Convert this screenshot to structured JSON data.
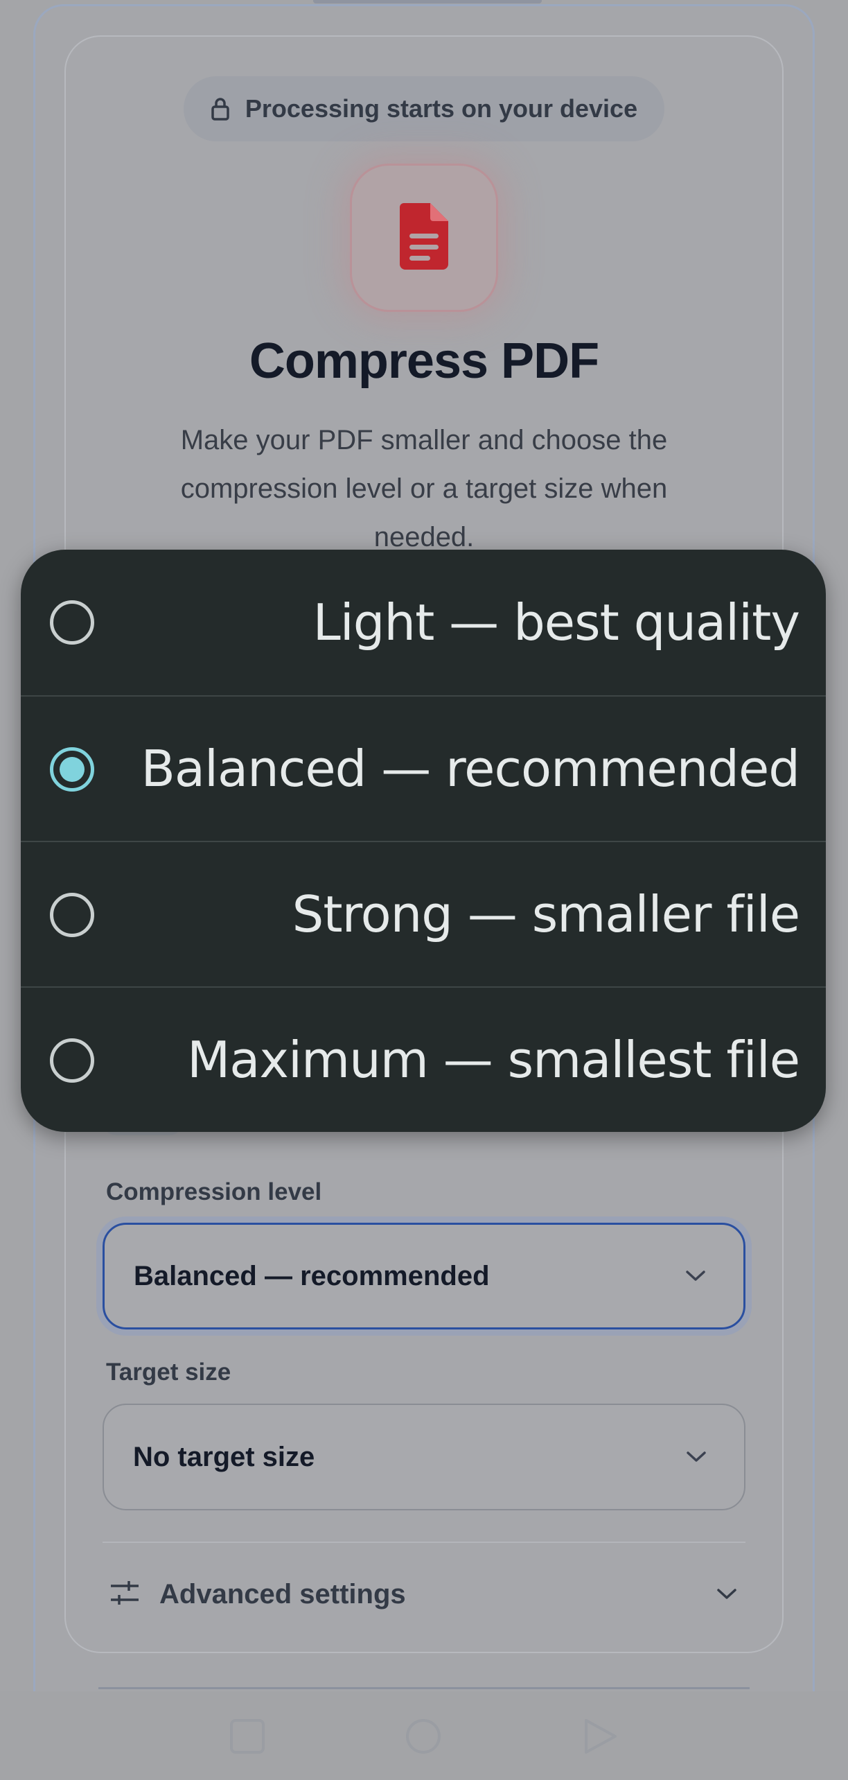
{
  "privacy_badge": {
    "text": "Processing starts on your device",
    "icon": "lock-icon"
  },
  "tool": {
    "icon": "pdf-file-icon",
    "title": "Compress PDF",
    "description": "Make your PDF smaller and choose the compression level or a target size when needed."
  },
  "compression_level": {
    "label": "Compression level",
    "selected": "Balanced — recommended",
    "options": [
      {
        "label": "Light — best quality",
        "checked": false
      },
      {
        "label": "Balanced — recommended",
        "checked": true
      },
      {
        "label": "Strong — smaller file",
        "checked": false
      },
      {
        "label": "Maximum — smallest file",
        "checked": false
      }
    ]
  },
  "target_size": {
    "label": "Target size",
    "selected": "No target size"
  },
  "advanced": {
    "label": "Advanced settings",
    "icon": "sliders-icon"
  },
  "colors": {
    "menu_background": "#242b2b",
    "radio_checked": "#80d3dd",
    "pdf_icon": "#c0262e",
    "focus_border": "#2a4fa0"
  }
}
